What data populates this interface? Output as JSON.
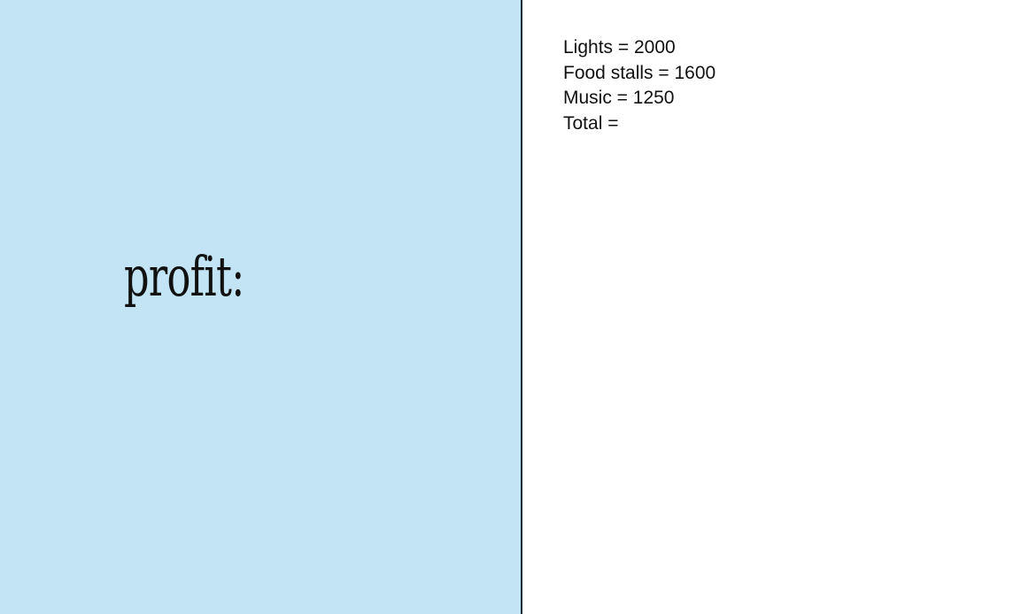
{
  "left_panel": {
    "title": "profit:",
    "background_color": "#c2e4f4",
    "divider_color": "#0f2a3a"
  },
  "right_panel": {
    "lines": [
      "Lights = 2000",
      "Food stalls = 1600",
      "Music = 1250",
      "Total ="
    ]
  }
}
